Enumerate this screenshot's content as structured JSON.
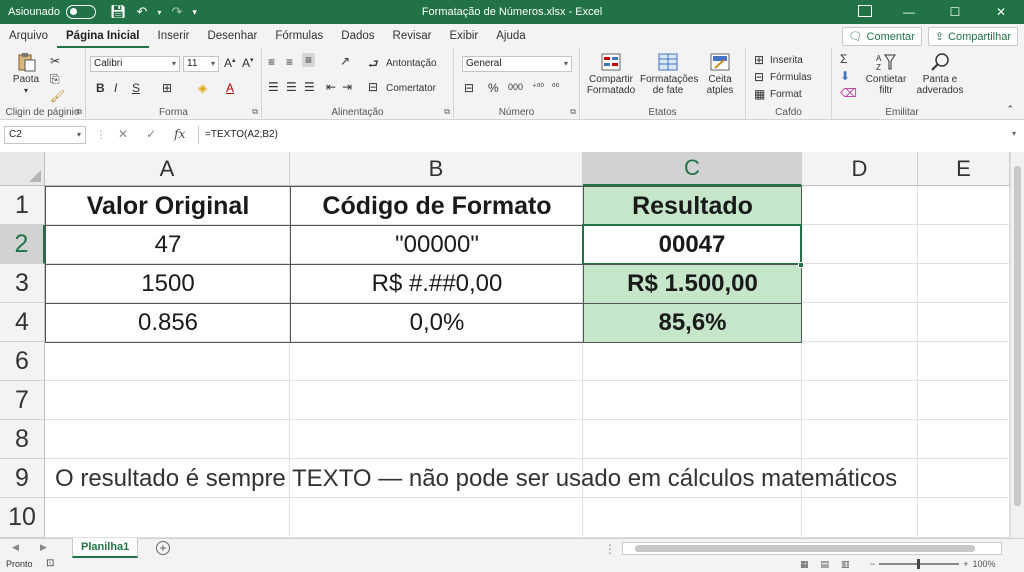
{
  "titlebar": {
    "autosave_label": "Asiounado",
    "title": "Formatação de Números.xlsx  -  Excel",
    "min": "—",
    "max": "☐",
    "close": "✕"
  },
  "tabs": [
    "Arquivo",
    "Página Inicial",
    "Inserir",
    "Desenhar",
    "Fórmulas",
    "Dados",
    "Revisar",
    "Exibir",
    "Ajuda"
  ],
  "share": {
    "comment": "Comentar",
    "share": "Compartilhar"
  },
  "ribbon": {
    "clipboard": {
      "paste": "Paota",
      "label": "Cligin de páginio"
    },
    "font": {
      "name": "Calibri",
      "size": "11",
      "label": "Forma"
    },
    "alignment": {
      "wrap": "Antontação",
      "merge": "Comertator",
      "label": "Alinentação"
    },
    "number": {
      "format": "General",
      "label": "Número"
    },
    "styles": {
      "cond": "Compartir Formatado",
      "table": "Formatações de fate",
      "cell": "Ceita atples",
      "label": "Etatos"
    },
    "cells": {
      "insert": "Inserita",
      "delete": "Fórmulas",
      "format": "Format",
      "label": "Cafdo"
    },
    "editing": {
      "sort": "Contietar filtr",
      "find": "Panta e adverados",
      "label": "Emilitar"
    }
  },
  "formula_bar": {
    "name_box": "C2",
    "formula": "=TEXTO(A2;B2)",
    "fx": "fx"
  },
  "columns": [
    "A",
    "B",
    "C",
    "D",
    "E"
  ],
  "rows": [
    "1",
    "2",
    "3",
    "4",
    "6",
    "7",
    "8",
    "9",
    "10"
  ],
  "cells": {
    "A1": "Valor Original",
    "B1": "Código de Formato",
    "C1": "Resultado",
    "A2": "47",
    "B2": "\"00000\"",
    "C2": "00047",
    "A3": "1500",
    "B3": "R$ #.##0,00",
    "C3": "R$ 1.500,00",
    "A4": "0.856",
    "B4": "0,0%",
    "C4": "85,6%",
    "A9": "O resultado é sempre TEXTO — não pode ser usado em cálculos matemáticos"
  },
  "sheet_tab": "Planilha1",
  "status": {
    "ready": "Pronto",
    "zoom": "100%"
  },
  "colors": {
    "accent": "#217346",
    "result_fill": "#c6e6ca"
  }
}
